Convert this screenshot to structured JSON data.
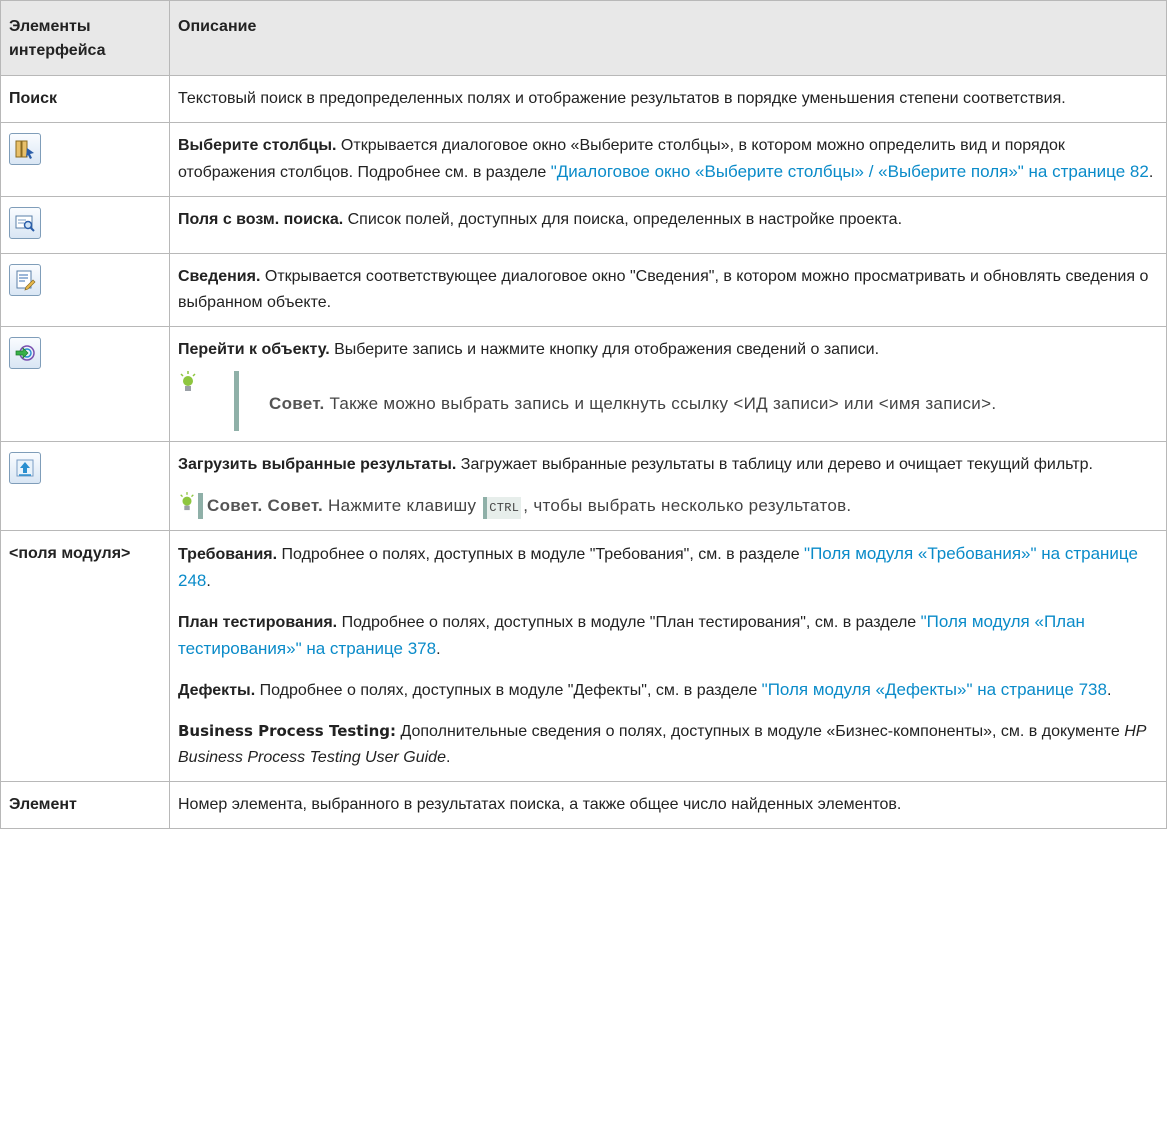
{
  "header": {
    "col1": "Элементы интерфейса",
    "col2": "Описание"
  },
  "rows": {
    "search": {
      "name": "Поиск",
      "desc": "Текстовый поиск в предопределенных полях и отображение результатов в порядке уменьшения степени соответствия."
    },
    "select_columns": {
      "icon": "select-columns-icon",
      "title": "Выберите столбцы.",
      "desc": " Открывается диалоговое окно «Выберите столбцы», в котором можно определить вид и порядок отображения столбцов. Подробнее см. в разделе ",
      "link": "\"Диалоговое окно «Выберите столбцы» / «Выберите поля»\" на странице 82",
      "end": "."
    },
    "searchable_fields": {
      "icon": "searchable-fields-icon",
      "title": "Поля с возм. поиска.",
      "desc": " Список полей, доступных для поиска, определенных в настройке проекта."
    },
    "details": {
      "icon": "details-icon",
      "title": "Сведения.",
      "desc": " Открывается соответствующее диалоговое окно \"Сведения\", в котором можно просматривать и обновлять сведения о выбранном объекте."
    },
    "go_to": {
      "icon": "go-to-object-icon",
      "title": "Перейти к объекту.",
      "desc": " Выберите запись и нажмите кнопку для отображения сведений о записи.",
      "tip_label": "Совет.",
      "tip_text": " Также можно выбрать запись и щелкнуть ссылку <ИД записи> или <имя записи>."
    },
    "load": {
      "icon": "load-selected-results-icon",
      "title": "Загрузить выбранные результаты.",
      "desc": " Загружает выбранные результаты в таблицу или дерево и очищает текущий фильтр.",
      "tip_label1": "Совет.",
      "tip_label2": "Совет.",
      "tip_pre": " Нажмите клавишу ",
      "tip_key": "CTRL",
      "tip_post": ", чтобы выбрать несколько результатов."
    },
    "module_fields": {
      "name": "<поля модуля>",
      "req_title": "Требования.",
      "req_desc": " Подробнее о полях, доступных в модуле \"Требования\", см. в разделе ",
      "req_link": "\"Поля модуля «Требования»\" на странице 248",
      "test_title": "План тестирования.",
      "test_desc": " Подробнее о полях, доступных в модуле \"План тестирования\", см. в разделе ",
      "test_link": "\"Поля модуля «План тестирования»\" на странице 378",
      "def_title": "Дефекты.",
      "def_desc": " Подробнее о полях, доступных в модуле \"Дефекты\", см. в разделе ",
      "def_link": "\"Поля модуля «Дефекты»\" на странице 738",
      "bpt_title": "Business Process Testing:",
      "bpt_desc": " Дополнительные сведения о полях, доступных в модуле «Бизнес-компоненты», см. в документе ",
      "bpt_doc": "HP Business Process Testing User Guide",
      "end": "."
    },
    "element": {
      "name": "Элемент",
      "desc": "Номер элемента, выбранного в результатах поиска, а также общее число найденных элементов."
    }
  }
}
